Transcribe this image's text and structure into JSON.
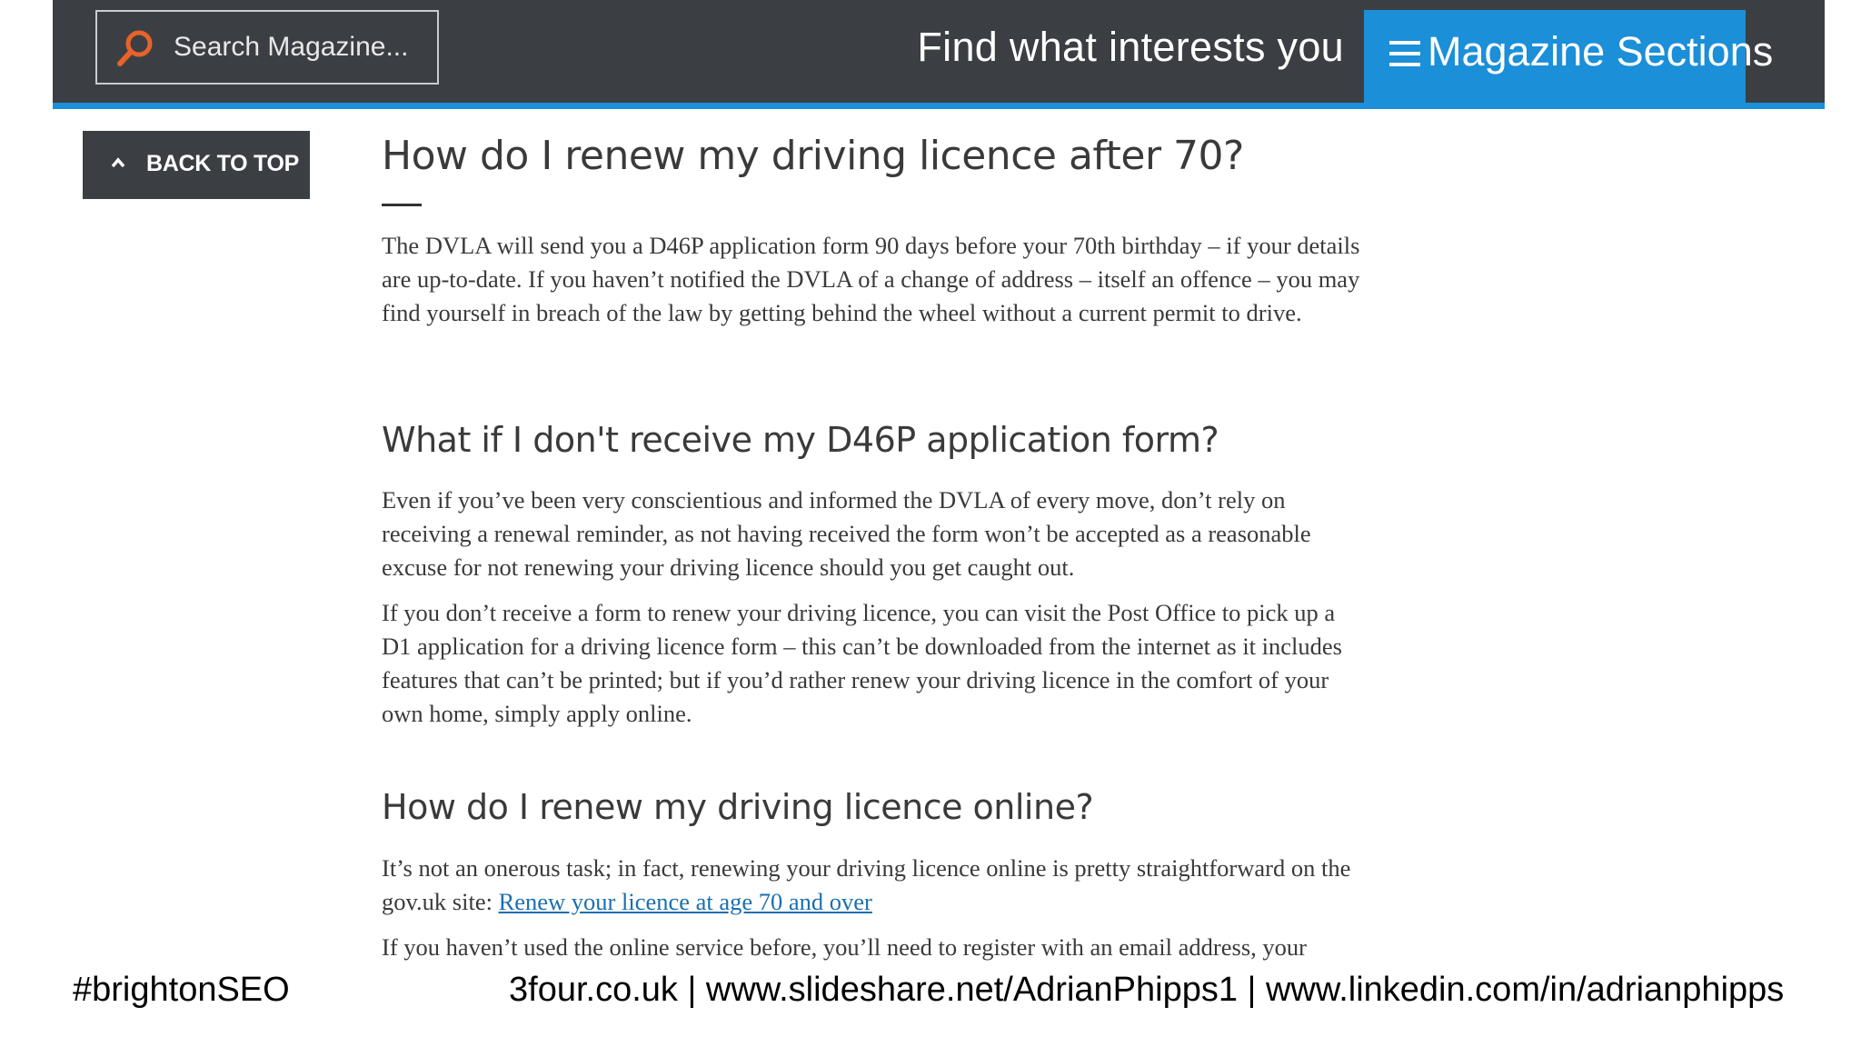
{
  "header": {
    "search_placeholder": "Search Magazine...",
    "tagline": "Find what interests you",
    "sections_label": "Magazine Sections"
  },
  "sidebar": {
    "back_to_top": "BACK TO TOP"
  },
  "article": {
    "title": "How do I renew my driving licence after 70?",
    "intro": "The DVLA will send you a D46P application form 90 days before your 70th birthday – if your details are up-to-date. If you haven’t notified the DVLA of a change of address – itself an offence – you may find yourself in breach of the law by getting behind the wheel without a current permit to drive.",
    "section1": {
      "heading": "What if I don't receive my D46P application form?",
      "para1": "Even if you’ve been very conscientious and informed the DVLA of every move, don’t rely on receiving a renewal reminder, as not having received the form won’t be accepted as a reasonable excuse for not renewing your driving licence should you get caught out.",
      "para2": "If you don’t receive a form to renew your driving licence, you can visit the Post Office to pick up a D1 application for a driving licence form – this can’t be downloaded from the internet as it includes features that can’t be printed; but if you’d rather renew your driving licence in the comfort of your own home, simply apply online."
    },
    "section2": {
      "heading": "How do I renew my driving licence online?",
      "para1_text": "It’s not an onerous task; in fact, renewing your driving licence online is pretty straightforward on the gov.uk site: ",
      "para1_link": "Renew your licence at age 70 and over",
      "para2": "If you haven’t used the online service before, you’ll need to register with an email address, your"
    }
  },
  "footer": {
    "hashtag": "#brightonSEO",
    "links": "3four.co.uk | www.slideshare.net/AdrianPhipps1 | www.linkedin.com/in/adrianphipps"
  },
  "colors": {
    "header_bg": "#3b3f44",
    "accent_blue": "#1b8fd8",
    "search_icon_orange": "#e8622a",
    "link_blue": "#1b6fb0"
  }
}
